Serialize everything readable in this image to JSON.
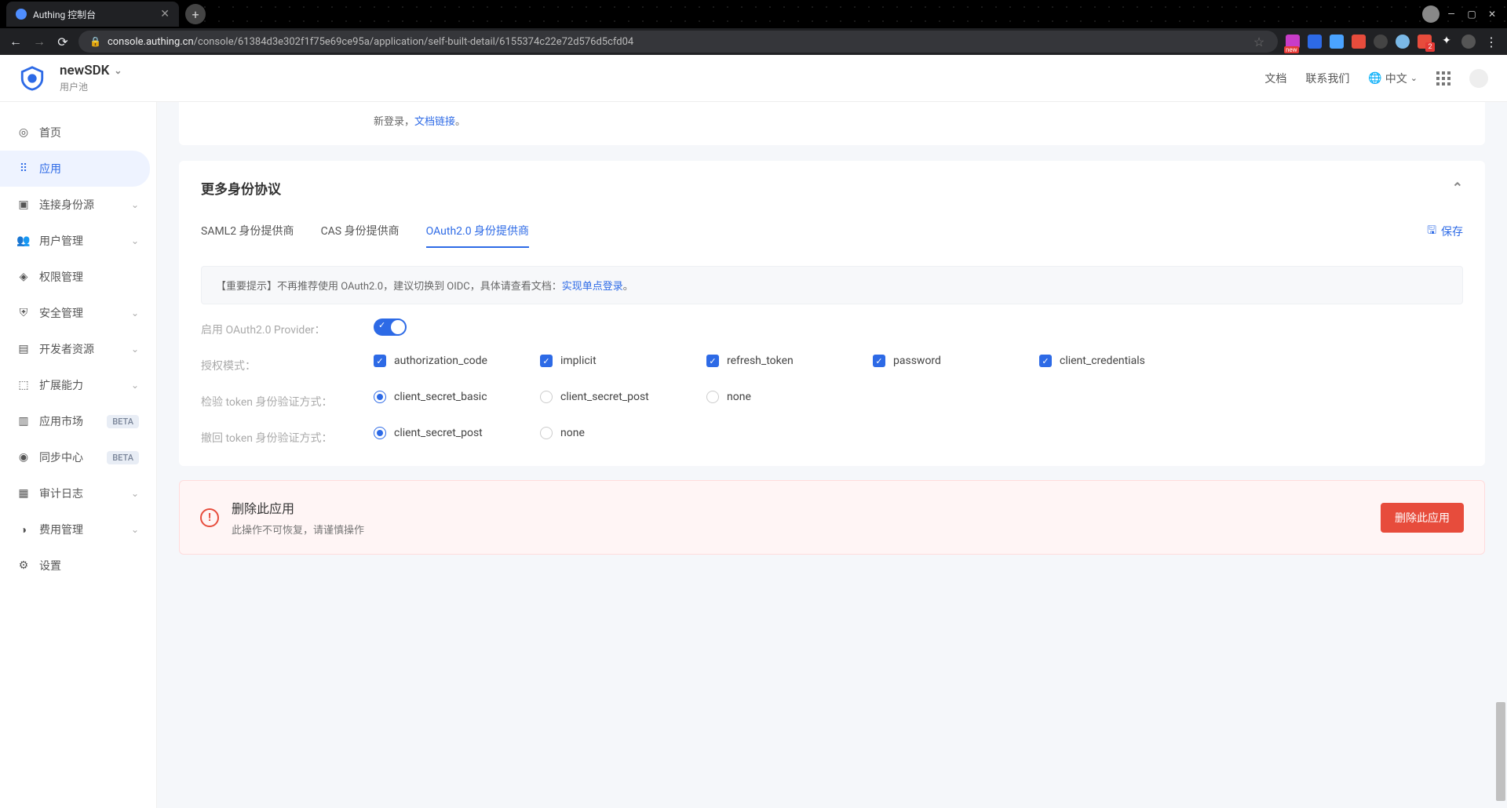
{
  "browser": {
    "tab_title": "Authing 控制台",
    "url_host": "console.authing.cn",
    "url_path": "/console/61384d3e302f1f75e69ce95a/application/self-built-detail/6155374c22e72d576d5cfd04"
  },
  "header": {
    "pool_name": "newSDK",
    "pool_sub": "用户池",
    "docs": "文档",
    "contact": "联系我们",
    "lang": "中文"
  },
  "sidebar": {
    "home": "首页",
    "app": "应用",
    "idp": "连接身份源",
    "users": "用户管理",
    "perm": "权限管理",
    "security": "安全管理",
    "dev": "开发者资源",
    "ext": "扩展能力",
    "market": "应用市场",
    "sync": "同步中心",
    "audit": "审计日志",
    "billing": "费用管理",
    "settings": "设置",
    "beta": "BETA"
  },
  "snippet": {
    "prefix": "新登录，",
    "link": "文档链接",
    "suffix": "。"
  },
  "panel": {
    "title": "更多身份协议",
    "tabs": {
      "saml": "SAML2 身份提供商",
      "cas": "CAS 身份提供商",
      "oauth": "OAuth2.0 身份提供商"
    },
    "save": "保存",
    "notice_prefix": "【重要提示】不再推荐使用 OAuth2.0，建议切换到 OIDC，具体请查看文档：",
    "notice_link": "实现单点登录",
    "notice_suffix": "。",
    "enable_label": "启用 OAuth2.0 Provider：",
    "grant_label": "授权模式：",
    "grants": {
      "auth_code": "authorization_code",
      "implicit": "implicit",
      "refresh": "refresh_token",
      "password": "password",
      "client_cred": "client_credentials"
    },
    "token_check_label": "检验 token 身份验证方式：",
    "token_check": {
      "basic": "client_secret_basic",
      "post": "client_secret_post",
      "none": "none"
    },
    "token_revoke_label": "撤回 token 身份验证方式：",
    "token_revoke": {
      "post": "client_secret_post",
      "none": "none"
    }
  },
  "danger": {
    "title": "删除此应用",
    "sub": "此操作不可恢复，请谨慎操作",
    "btn": "删除此应用"
  }
}
